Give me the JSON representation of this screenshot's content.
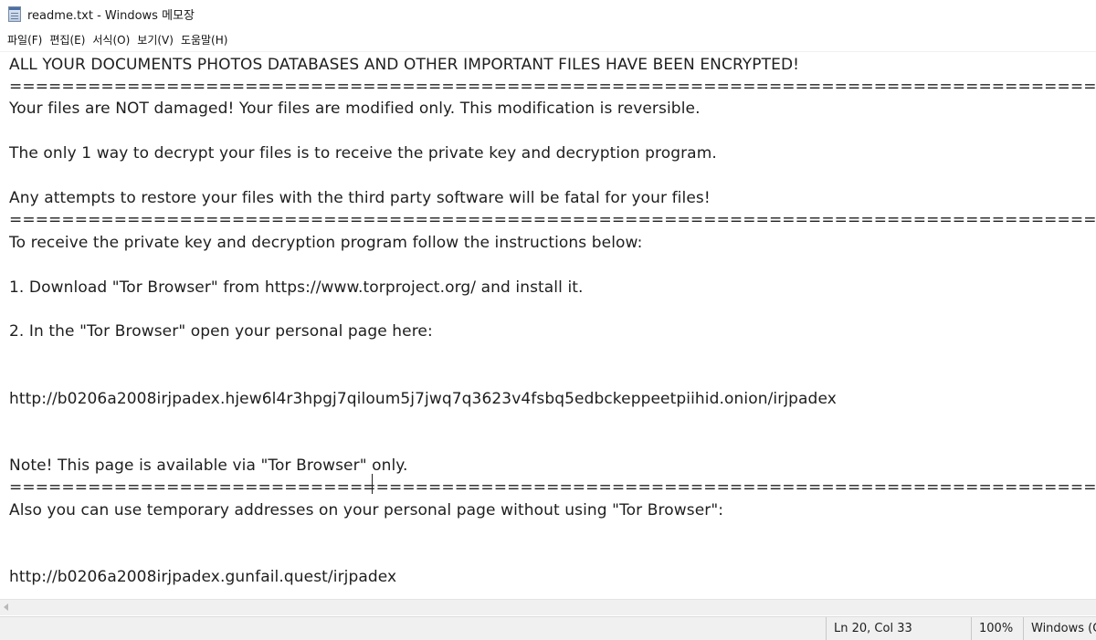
{
  "window": {
    "title": "readme.txt - Windows 메모장",
    "icon": "notepad-icon"
  },
  "menu": [
    {
      "label": "파일(F)",
      "name": "menu-file"
    },
    {
      "label": "편집(E)",
      "name": "menu-edit"
    },
    {
      "label": "서식(O)",
      "name": "menu-format"
    },
    {
      "label": "보기(V)",
      "name": "menu-view"
    },
    {
      "label": "도움말(H)",
      "name": "menu-help"
    }
  ],
  "document": {
    "lines": [
      "ALL YOUR DOCUMENTS PHOTOS DATABASES AND OTHER IMPORTANT FILES HAVE BEEN ENCRYPTED!",
      "================================================================================================================================",
      "Your files are NOT damaged! Your files are modified only. This modification is reversible.",
      "The only 1 way to decrypt your files is to receive the private key and decryption program.",
      "Any attempts to restore your files with the third party software will be fatal for your files!",
      "================================================================================================================================",
      "To receive the private key and decryption program follow the instructions below:",
      "1. Download \"Tor Browser\" from https://www.torproject.org/ and install it.",
      "2. In the \"Tor Browser\" open your personal page here:",
      "http://b0206a2008irjpadex.hjew6l4r3hpgj7qiloum5j7jwq7q3623v4fsbq5edbckeppeetpiihid.onion/irjpadex",
      "Note! This page is available via \"Tor Browser\" only.",
      "================================================================================================================================",
      "Also you can use temporary addresses on your personal page without using \"Tor Browser\":",
      "http://b0206a2008irjpadex.gunfail.quest/irjpadex"
    ]
  },
  "status": {
    "position": "Ln 20, Col 33",
    "zoom": "100%",
    "line_ending": "Windows (CRLF)"
  }
}
